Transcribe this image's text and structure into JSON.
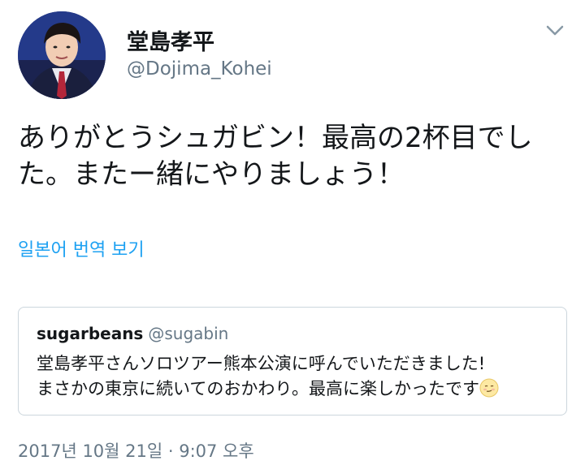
{
  "author": {
    "display_name": "堂島孝平",
    "handle": "@Dojima_Kohei"
  },
  "tweet": {
    "text_line1": "ありがとうシュガビン！最高の2杯目でし",
    "text_line2": "た。またー緒にやりましょう！",
    "translate_label": "일본어 번역 보기",
    "timestamp": "2017년 10월 21일 · 9:07 오후"
  },
  "quoted": {
    "name": "sugarbeans",
    "handle": "@sugabin",
    "text_line1": "堂島孝平さんソロツアー熊本公演に呼んでいただきました!",
    "text_line2": "まさかの東京に続いてのおかわり。最高に楽しかったです"
  },
  "icons": {
    "menu": "chevron-down-icon",
    "emoji": "smiling-face-emoji"
  },
  "colors": {
    "link": "#1da1f2",
    "secondary_text": "#657786",
    "border": "#ccd6dd"
  }
}
